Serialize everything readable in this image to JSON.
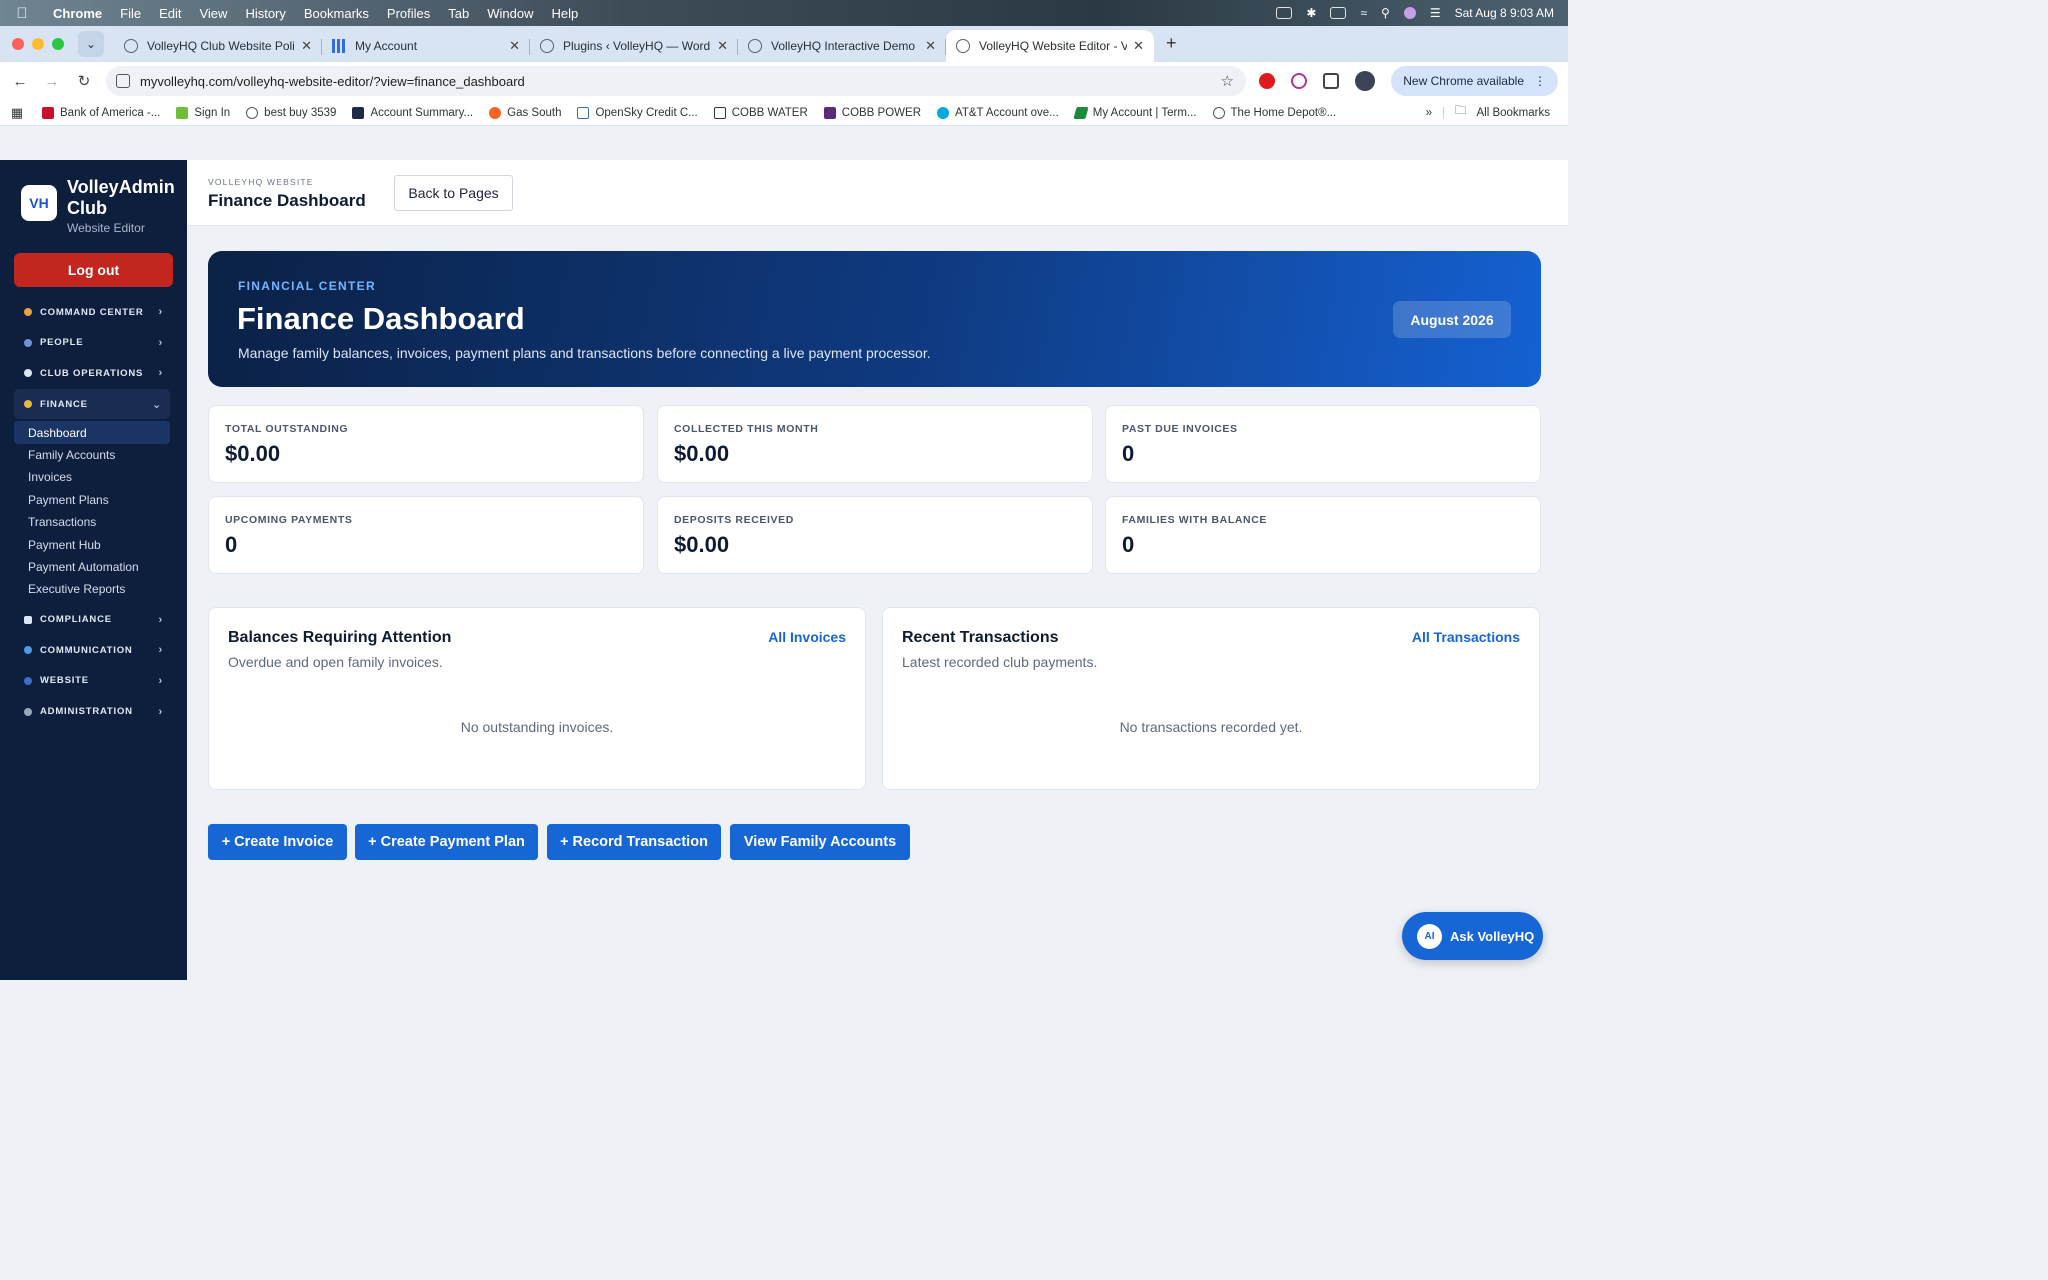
{
  "os_menu": {
    "apple": "",
    "app": "Chrome",
    "items": [
      "File",
      "Edit",
      "View",
      "History",
      "Bookmarks",
      "Profiles",
      "Tab",
      "Window",
      "Help"
    ],
    "clock": "Sat Aug 8  9:03 AM"
  },
  "browser": {
    "tabs": [
      {
        "title": "VolleyHQ Club Website Polish"
      },
      {
        "title": "My Account"
      },
      {
        "title": "Plugins ‹ VolleyHQ — WordPr"
      },
      {
        "title": "VolleyHQ Interactive Demo - "
      },
      {
        "title": "VolleyHQ Website Editor - Vo"
      }
    ],
    "url": "myvolleyhq.com/volleyhq-website-editor/?view=finance_dashboard",
    "update_label": "New Chrome available",
    "bookmarks": [
      "Bank of America -...",
      "Sign In",
      "best buy 3539",
      "Account Summary...",
      "Gas South",
      "OpenSky Credit C...",
      "COBB WATER",
      "COBB POWER",
      "AT&T Account ove...",
      "My Account | Term...",
      "The Home Depot®..."
    ],
    "all_bookmarks": "All Bookmarks"
  },
  "sidebar": {
    "logo": "VH",
    "title": "VolleyAdmin Club",
    "subtitle": "Website Editor",
    "logout": "Log out",
    "sections_top": [
      "COMMAND CENTER",
      "PEOPLE",
      "CLUB OPERATIONS"
    ],
    "finance": {
      "label": "FINANCE",
      "items": [
        "Dashboard",
        "Family Accounts",
        "Invoices",
        "Payment Plans",
        "Transactions",
        "Payment Hub",
        "Payment Automation",
        "Executive Reports"
      ]
    },
    "sections_bottom": [
      "COMPLIANCE",
      "COMMUNICATION",
      "WEBSITE",
      "ADMINISTRATION"
    ]
  },
  "header": {
    "breadcrumb": "VOLLEYHQ WEBSITE",
    "title": "Finance Dashboard",
    "back": "Back to Pages"
  },
  "hero": {
    "eyebrow": "FINANCIAL CENTER",
    "title": "Finance Dashboard",
    "description": "Manage family balances, invoices, payment plans and transactions before connecting a live payment processor.",
    "month": "August 2026"
  },
  "stats": [
    {
      "label": "TOTAL OUTSTANDING",
      "value": "$0.00"
    },
    {
      "label": "COLLECTED THIS MONTH",
      "value": "$0.00"
    },
    {
      "label": "PAST DUE INVOICES",
      "value": "0"
    },
    {
      "label": "UPCOMING PAYMENTS",
      "value": "0"
    },
    {
      "label": "DEPOSITS RECEIVED",
      "value": "$0.00"
    },
    {
      "label": "FAMILIES WITH BALANCE",
      "value": "0"
    }
  ],
  "panels": {
    "balances": {
      "title": "Balances Requiring Attention",
      "subtitle": "Overdue and open family invoices.",
      "link": "All Invoices",
      "empty": "No outstanding invoices."
    },
    "transactions": {
      "title": "Recent Transactions",
      "subtitle": "Latest recorded club payments.",
      "link": "All Transactions",
      "empty": "No transactions recorded yet."
    }
  },
  "actions": [
    "+ Create Invoice",
    "+ Create Payment Plan",
    "+ Record Transaction",
    "View Family Accounts"
  ],
  "assistant": {
    "badge": "AI",
    "label": "Ask VolleyHQ"
  },
  "colors": {
    "accent": "#1666d6",
    "sidebar": "#0e1e3d",
    "logout": "#c3261f"
  }
}
